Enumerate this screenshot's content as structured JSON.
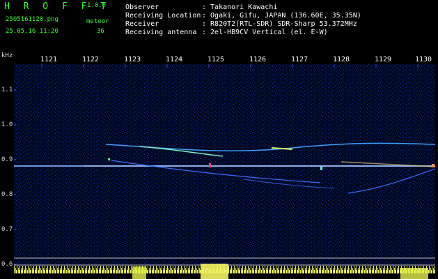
{
  "app": {
    "title": "H R O F F T",
    "version": "1.0.0"
  },
  "file": {
    "name": "2505161120.png",
    "datetime": "25.05.16 11:20"
  },
  "counter": {
    "label": "meteor",
    "count": "36"
  },
  "info": [
    {
      "key": "Observer",
      "value": ": Takanori Kawachi"
    },
    {
      "key": "Receiving Location",
      "value": ": Ogaki, Gifu, JAPAN (136.60E, 35.35N)"
    },
    {
      "key": "Receiver",
      "value": ": R820T2(RTL-SDR) SDR-Sharp 53.372MHz"
    },
    {
      "key": "Receiving antenna",
      "value": ": 2el-HB9CV Vertical (el. E-W)"
    }
  ],
  "y_axis": {
    "unit": "kHz",
    "ticks": [
      "1.1",
      "1.0",
      "0.9",
      "0.8",
      "0.7",
      "0.6"
    ]
  },
  "x_axis": {
    "ticks": [
      "1121",
      "1122",
      "1123",
      "1124",
      "1125",
      "1126",
      "1127",
      "1128",
      "1129",
      "1130"
    ]
  },
  "colors": {
    "accent": "#33ff33",
    "background": "#000000",
    "carrier": "#7fb0ff"
  }
}
